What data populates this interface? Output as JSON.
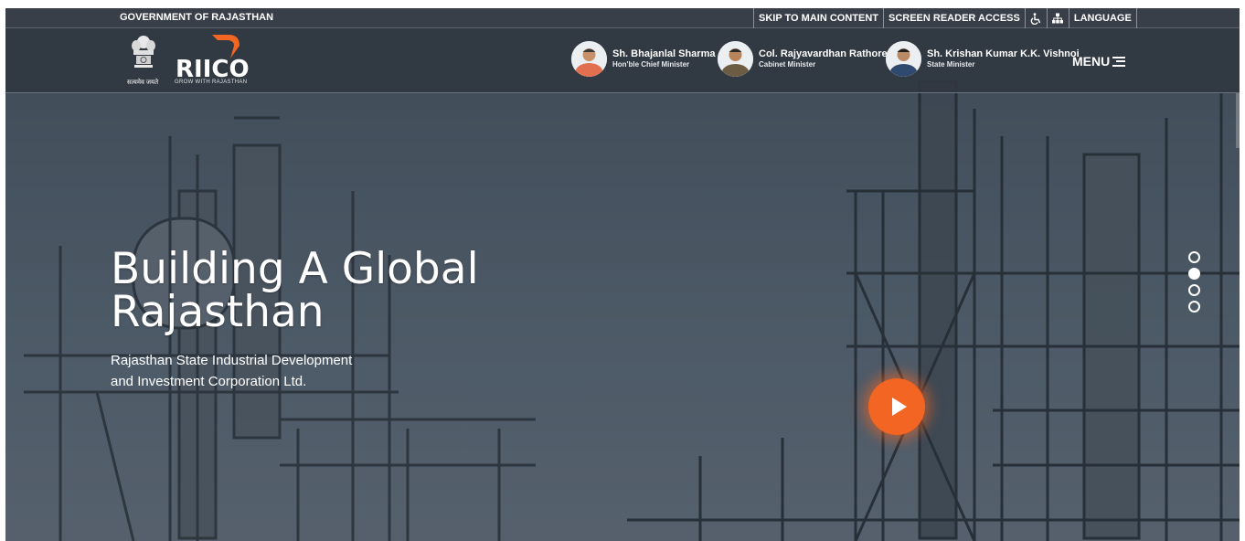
{
  "topbar": {
    "gov_label": "GOVERNMENT OF RAJASTHAN",
    "skip_label": "SKIP TO MAIN CONTENT",
    "reader_label": "SCREEN READER ACCESS",
    "accessibility_icon": "wheelchair-icon",
    "sitemap_icon": "sitemap-icon",
    "language_label": "LANGUAGE"
  },
  "header": {
    "logo_text": "RIICO",
    "tagline_hindi": "सत्यमेव जयते",
    "tagline_en": "GROW WITH RAJASTHAN",
    "brand_color": "#f26522",
    "ministers": [
      {
        "name": "Sh. Bhajanlal Sharma",
        "role": "Hon'ble Chief Minister"
      },
      {
        "name": "Col. Rajyavardhan Rathore",
        "role": "Cabinet Minister"
      },
      {
        "name": "Sh. Krishan Kumar K.K. Vishnoi",
        "role": "State Minister"
      }
    ],
    "menu_label": "MENU"
  },
  "hero": {
    "title_line1": "Building A Global",
    "title_line2": "Rajasthan",
    "subtitle_line1": "Rajasthan State Industrial Development",
    "subtitle_line2": "and Investment Corporation Ltd.",
    "play_icon": "play-icon",
    "slides_total": 4,
    "active_slide": 2
  }
}
